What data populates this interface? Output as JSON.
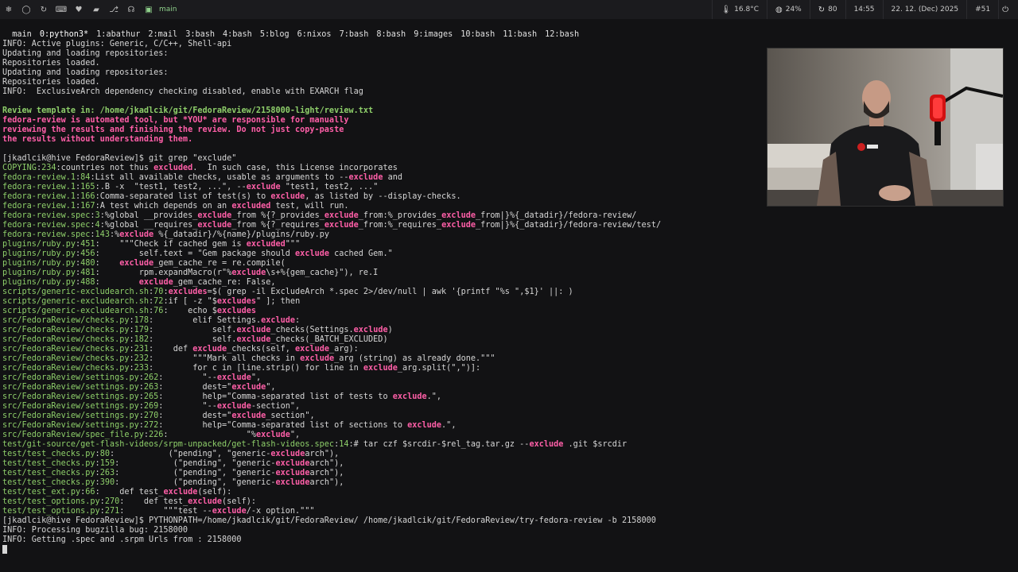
{
  "topbar": {
    "icons": [
      "os-logo-icon",
      "chat-icon",
      "refresh-icon",
      "keyboard-icon",
      "heart-icon",
      "folder-icon",
      "git-icon",
      "headphones-icon",
      "terminal-icon"
    ],
    "workspace_name": "main",
    "status": {
      "temperature": "16.8°C",
      "cpu": "24%",
      "updates": "80",
      "time": "14:55",
      "date": "22. 12. (Dec) 2025",
      "workspace_number": "#51"
    }
  },
  "tmux": {
    "session": "main",
    "windows": [
      {
        "label": "0:python3*",
        "active": true
      },
      {
        "label": "1:abathur",
        "active": false
      },
      {
        "label": "2:mail",
        "active": false
      },
      {
        "label": "3:bash",
        "active": false
      },
      {
        "label": "4:bash",
        "active": false
      },
      {
        "label": "5:blog",
        "active": false
      },
      {
        "label": "6:nixos",
        "active": false
      },
      {
        "label": "7:bash",
        "active": false
      },
      {
        "label": "8:bash",
        "active": false
      },
      {
        "label": "9:images",
        "active": false
      },
      {
        "label": "10:bash",
        "active": false
      },
      {
        "label": "11:bash",
        "active": false
      },
      {
        "label": "12:bash",
        "active": false
      }
    ]
  },
  "terminal": {
    "lines": [
      {
        "t": "plain",
        "text": "INFO: Active plugins: Generic, C/C++, Shell-api"
      },
      {
        "t": "plain",
        "text": "Updating and loading repositories:"
      },
      {
        "t": "plain",
        "text": "Repositories loaded."
      },
      {
        "t": "plain",
        "text": "Updating and loading repositories:"
      },
      {
        "t": "plain",
        "text": "Repositories loaded."
      },
      {
        "t": "plain",
        "text": "INFO:  ExclusiveArch dependency checking disabled, enable with EXARCH flag"
      },
      {
        "t": "plain",
        "text": ""
      },
      {
        "t": "green",
        "text": "Review template in: /home/jkadlcik/git/FedoraReview/2158000-light/review.txt"
      },
      {
        "t": "red",
        "text": "fedora-review is automated tool, but *YOU* are responsible for manually"
      },
      {
        "t": "red",
        "text": "reviewing the results and finishing the review. Do not just copy-paste"
      },
      {
        "t": "red",
        "text": "the results without understanding them."
      },
      {
        "t": "plain",
        "text": ""
      },
      {
        "t": "plain",
        "text": "[jkadlcik@hive FedoraReview]$ git grep \"exclude\""
      },
      {
        "t": "grep",
        "file": "COPYING",
        "num": "234",
        "text": "countries not thus [[excluded]].  In such case, this License incorporates"
      },
      {
        "t": "grep",
        "file": "fedora-review.1",
        "num": "84",
        "text": "List all available checks, usable as arguments to --[[exclude]] and"
      },
      {
        "t": "grep",
        "file": "fedora-review.1",
        "num": "165",
        "text": ".B -x  \"test1, test2, ...\", --[[exclude]] \"test1, test2, ...\""
      },
      {
        "t": "grep",
        "file": "fedora-review.1",
        "num": "166",
        "text": "Comma-separated list of test(s) to [[exclude]], as listed by --display-checks."
      },
      {
        "t": "grep",
        "file": "fedora-review.1",
        "num": "167",
        "text": "A test which depends on an [[excluded]] test, will run."
      },
      {
        "t": "grep",
        "file": "fedora-review.spec",
        "num": "3",
        "text": "%global __provides_[[exclude]]_from %{?_provides_[[exclude]]_from:%_provides_[[exclude]]_from|}%{_datadir}/fedora-review/"
      },
      {
        "t": "grep",
        "file": "fedora-review.spec",
        "num": "4",
        "text": "%global __requires_[[exclude]]_from %{?_requires_[[exclude]]_from:%_requires_[[exclude]]_from|}%{_datadir}/fedora-review/test/"
      },
      {
        "t": "grep",
        "file": "fedora-review.spec",
        "num": "143",
        "text": "%[[exclude]] %{_datadir}/%{name}/plugins/ruby.py"
      },
      {
        "t": "grep",
        "file": "plugins/ruby.py",
        "num": "451",
        "text": "    \"\"\"Check if cached gem is [[excluded]]\"\"\""
      },
      {
        "t": "grep",
        "file": "plugins/ruby.py",
        "num": "456",
        "text": "        self.text = \"Gem package should [[exclude]] cached Gem.\""
      },
      {
        "t": "grep",
        "file": "plugins/ruby.py",
        "num": "480",
        "text": "    [[exclude]]_gem_cache_re = re.compile("
      },
      {
        "t": "grep",
        "file": "plugins/ruby.py",
        "num": "481",
        "text": "        rpm.expandMacro(r\"%[[exclude]]\\s+%{gem_cache}\"), re.I"
      },
      {
        "t": "grep",
        "file": "plugins/ruby.py",
        "num": "488",
        "text": "        [[exclude]]_gem_cache_re: False,"
      },
      {
        "t": "grep",
        "file": "scripts/generic-excludearch.sh",
        "num": "70",
        "text": "[[excludes]]=$( grep -il ExcludeArch *.spec 2>/dev/null | awk '{printf \"%s \",$1}' ||: )"
      },
      {
        "t": "grep",
        "file": "scripts/generic-excludearch.sh",
        "num": "72",
        "text": "if [ -z \"$[[excludes]]\" ]; then"
      },
      {
        "t": "grep",
        "file": "scripts/generic-excludearch.sh",
        "num": "76",
        "text": "    echo $[[excludes]]"
      },
      {
        "t": "grep",
        "file": "src/FedoraReview/checks.py",
        "num": "178",
        "text": "        elif Settings.[[exclude]]:"
      },
      {
        "t": "grep",
        "file": "src/FedoraReview/checks.py",
        "num": "179",
        "text": "            self.[[exclude]]_checks(Settings.[[exclude]])"
      },
      {
        "t": "grep",
        "file": "src/FedoraReview/checks.py",
        "num": "182",
        "text": "            self.[[exclude]]_checks(_BATCH_EXCLUDED)"
      },
      {
        "t": "grep",
        "file": "src/FedoraReview/checks.py",
        "num": "231",
        "text": "    def [[exclude]]_checks(self, [[exclude]]_arg):"
      },
      {
        "t": "grep",
        "file": "src/FedoraReview/checks.py",
        "num": "232",
        "text": "        \"\"\"Mark all checks in [[exclude]]_arg (string) as already done.\"\"\""
      },
      {
        "t": "grep",
        "file": "src/FedoraReview/checks.py",
        "num": "233",
        "text": "        for c in [line.strip() for line in [[exclude]]_arg.split(\",\")]:"
      },
      {
        "t": "grep",
        "file": "src/FedoraReview/settings.py",
        "num": "262",
        "text": "        \"--[[exclude]]\","
      },
      {
        "t": "grep",
        "file": "src/FedoraReview/settings.py",
        "num": "263",
        "text": "        dest=\"[[exclude]]\","
      },
      {
        "t": "grep",
        "file": "src/FedoraReview/settings.py",
        "num": "265",
        "text": "        help=\"Comma-separated list of tests to [[exclude]].\","
      },
      {
        "t": "grep",
        "file": "src/FedoraReview/settings.py",
        "num": "269",
        "text": "        \"--[[exclude]]-section\","
      },
      {
        "t": "grep",
        "file": "src/FedoraReview/settings.py",
        "num": "270",
        "text": "        dest=\"[[exclude]]_section\","
      },
      {
        "t": "grep",
        "file": "src/FedoraReview/settings.py",
        "num": "272",
        "text": "        help=\"Comma-separated list of sections to [[exclude]].\","
      },
      {
        "t": "grep",
        "file": "src/FedoraReview/spec_file.py",
        "num": "226",
        "text": "                \"%[[exclude]]\","
      },
      {
        "t": "grep",
        "file": "test/git-source/get-flash-videos/srpm-unpacked/get-flash-videos.spec",
        "num": "14",
        "text": "# tar czf $srcdir-$rel_tag.tar.gz --[[exclude]] .git $srcdir"
      },
      {
        "t": "grep",
        "file": "test/test_checks.py",
        "num": "80",
        "text": "           (\"pending\", \"generic-[[exclude]]arch\"),"
      },
      {
        "t": "grep",
        "file": "test/test_checks.py",
        "num": "159",
        "text": "           (\"pending\", \"generic-[[exclude]]arch\"),"
      },
      {
        "t": "grep",
        "file": "test/test_checks.py",
        "num": "263",
        "text": "           (\"pending\", \"generic-[[exclude]]arch\"),"
      },
      {
        "t": "grep",
        "file": "test/test_checks.py",
        "num": "390",
        "text": "           (\"pending\", \"generic-[[exclude]]arch\"),"
      },
      {
        "t": "grep",
        "file": "test/test_ext.py",
        "num": "66",
        "text": "    def test_[[exclude]](self):"
      },
      {
        "t": "grep",
        "file": "test/test_options.py",
        "num": "270",
        "text": "    def test_[[exclude]](self):"
      },
      {
        "t": "grep",
        "file": "test/test_options.py",
        "num": "271",
        "text": "        \"\"\"test --[[exclude]]/-x option.\"\"\""
      },
      {
        "t": "plain",
        "text": "[jkadlcik@hive FedoraReview]$ PYTHONPATH=/home/jkadlcik/git/FedoraReview/ /home/jkadlcik/git/FedoraReview/try-fedora-review -b 2158000"
      },
      {
        "t": "plain",
        "text": "INFO: Processing bugzilla bug: 2158000"
      },
      {
        "t": "plain",
        "text": "INFO: Getting .spec and .srpm Urls from : 2158000"
      }
    ]
  }
}
